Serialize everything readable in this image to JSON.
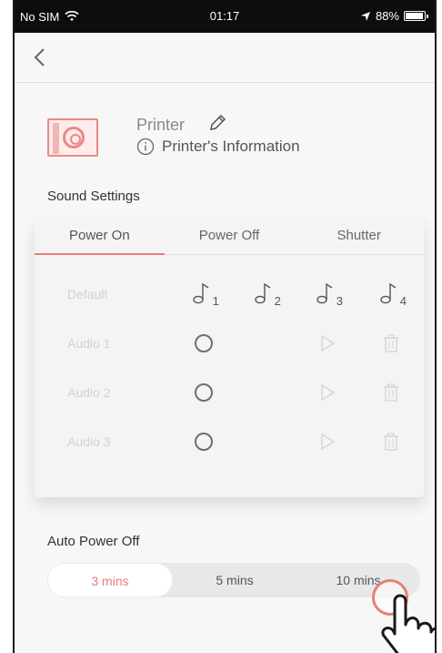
{
  "status_bar": {
    "carrier": "No SIM",
    "time": "01:17",
    "battery": "88%"
  },
  "printer": {
    "name": "Printer",
    "info_label": "Printer's Information"
  },
  "sound_settings": {
    "title": "Sound Settings",
    "tabs": [
      "Power On",
      "Power Off",
      "Shutter"
    ],
    "active_tab": "Power On",
    "rows": [
      {
        "label": "Default",
        "tones": [
          "1",
          "2",
          "3",
          "4"
        ]
      },
      {
        "label": "Audio 1"
      },
      {
        "label": "Audio 2"
      },
      {
        "label": "Audio 3"
      }
    ]
  },
  "auto_power_off": {
    "title": "Auto Power Off",
    "options": [
      "3 mins",
      "5 mins",
      "10 mins"
    ],
    "selected": "3 mins"
  },
  "colors": {
    "accent": "#e77f7a",
    "status_bar": "#0d0d0d",
    "background": "#f7f7f7"
  },
  "icons": [
    "back-chevron-icon",
    "printer-icon",
    "pencil-icon",
    "info-icon",
    "music-note-icon",
    "play-icon",
    "trash-icon",
    "hand-pointer-icon"
  ]
}
